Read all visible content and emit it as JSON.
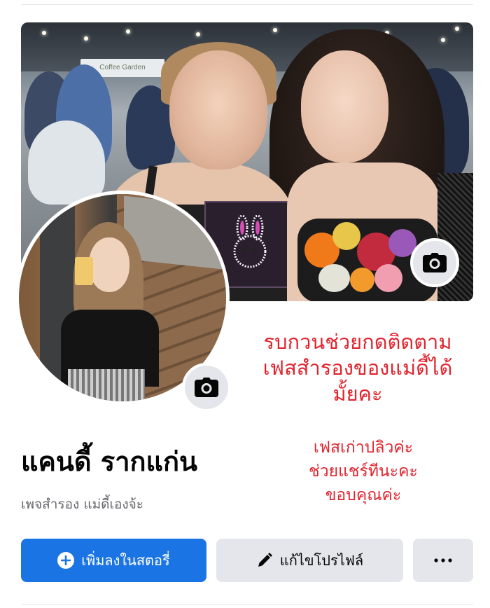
{
  "profile": {
    "name": "แคนดี้ รากแก่น",
    "subtitle": "เพจสำรอง แม่ดี้เองจ้ะ"
  },
  "overlay": {
    "main_lines": [
      "รบกวนช่วยกดติดตาม",
      "เฟสสำรองของแม่ดี้ได้",
      "มั้ยคะ"
    ],
    "secondary_lines": [
      "เฟสเก่าปลิวค่ะ",
      "ช่วยแชร์ทีนะคะ",
      "ขอบคุณค่ะ"
    ],
    "color": "#e1232d"
  },
  "cover": {
    "sign_text": "Coffee Garden"
  },
  "actions": {
    "add_story_label": "เพิ่มลงในสตอรี่",
    "edit_profile_label": "แก้ไขโปรไฟล์",
    "more_label": "···"
  },
  "icons": {
    "cover_camera": "camera-icon",
    "profile_camera": "camera-icon",
    "add_story": "plus-circle-icon",
    "edit": "pencil-icon",
    "more": "more-icon"
  },
  "colors": {
    "primary": "#1b74e4",
    "secondary_button": "#e4e6eb",
    "text": "#050505",
    "muted_text": "#65676b"
  }
}
